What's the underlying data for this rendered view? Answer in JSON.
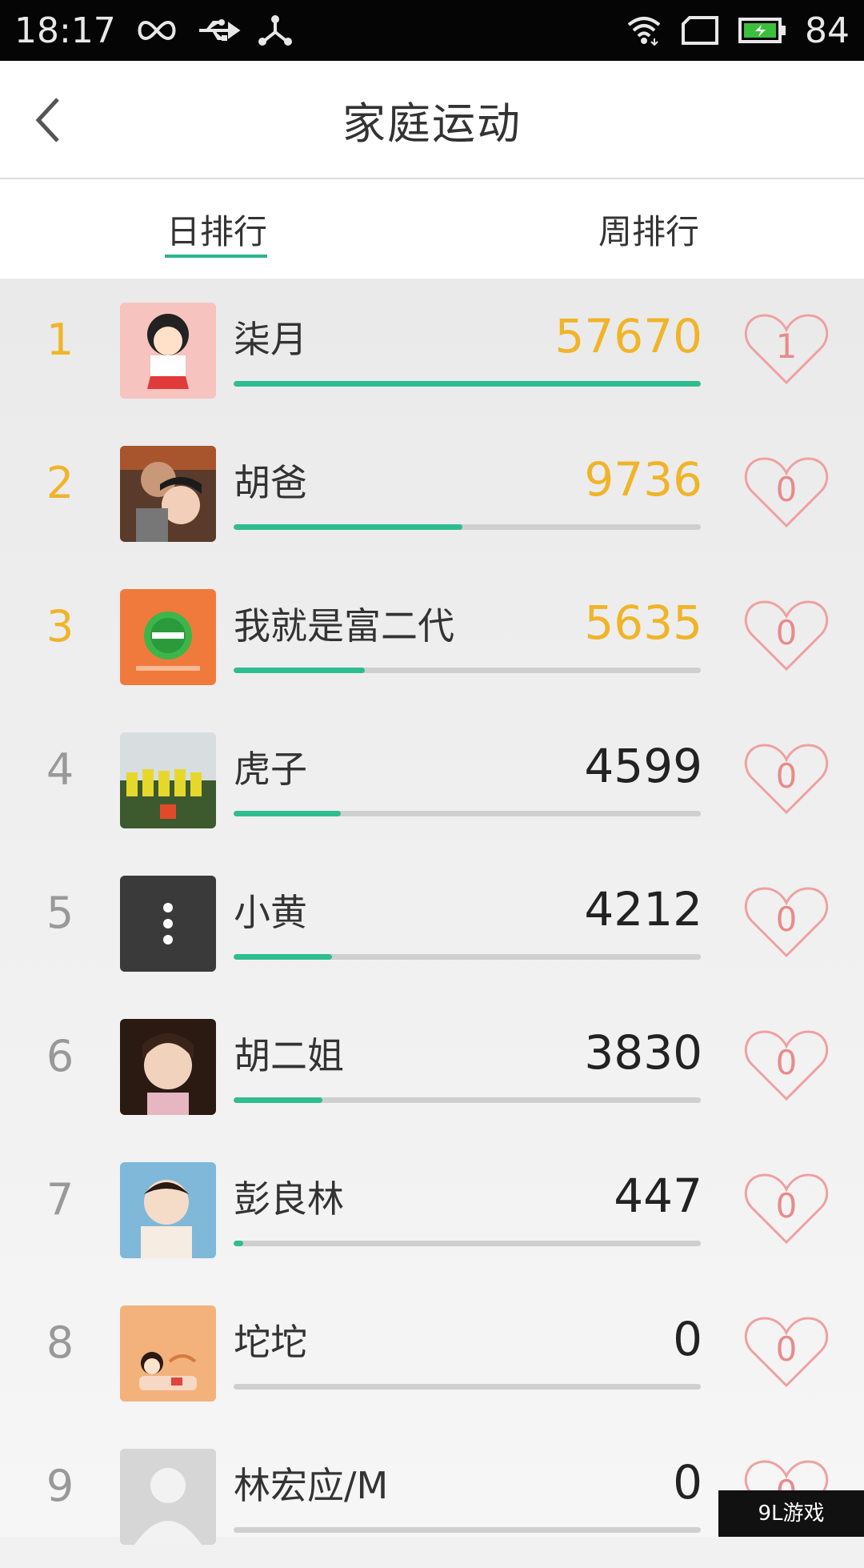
{
  "status_bar": {
    "time": "18:17",
    "battery": "84"
  },
  "header": {
    "title": "家庭运动"
  },
  "tabs": [
    {
      "label": "日排行"
    },
    {
      "label": "周排行"
    }
  ],
  "accent_color": "#2ebd8f",
  "top_rank_color": "#f0b429",
  "leaderboard": [
    {
      "rank": "1",
      "name": "柒月",
      "steps": "57670",
      "likes": "1",
      "progress": 1.0
    },
    {
      "rank": "2",
      "name": "胡爸",
      "steps": "9736",
      "likes": "0",
      "progress": 0.49
    },
    {
      "rank": "3",
      "name": "我就是富二代",
      "steps": "5635",
      "likes": "0",
      "progress": 0.28
    },
    {
      "rank": "4",
      "name": "虎子",
      "steps": "4599",
      "likes": "0",
      "progress": 0.23
    },
    {
      "rank": "5",
      "name": "小黄",
      "steps": "4212",
      "likes": "0",
      "progress": 0.21
    },
    {
      "rank": "6",
      "name": "胡二姐",
      "steps": "3830",
      "likes": "0",
      "progress": 0.19
    },
    {
      "rank": "7",
      "name": "彭良林",
      "steps": "447",
      "likes": "0",
      "progress": 0.02
    },
    {
      "rank": "8",
      "name": "坨坨",
      "steps": "0",
      "likes": "0",
      "progress": 0
    },
    {
      "rank": "9",
      "name": "林宏应/M",
      "steps": "0",
      "likes": "0",
      "progress": 0
    }
  ],
  "watermark": {
    "text": "9L游戏"
  }
}
